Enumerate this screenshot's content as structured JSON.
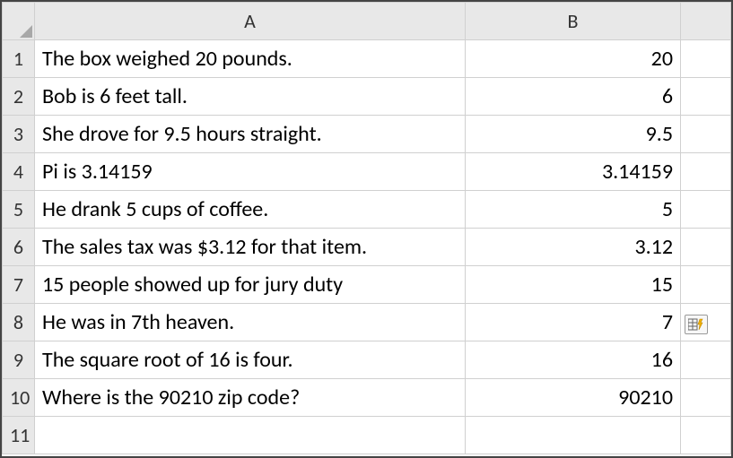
{
  "columns": {
    "A": "A",
    "B": "B"
  },
  "rows": [
    {
      "n": "1",
      "a": "The box weighed 20 pounds.",
      "b": "20"
    },
    {
      "n": "2",
      "a": "Bob is 6 feet tall.",
      "b": "6"
    },
    {
      "n": "3",
      "a": "She drove for 9.5 hours straight.",
      "b": "9.5"
    },
    {
      "n": "4",
      "a": "Pi is 3.14159",
      "b": "3.14159"
    },
    {
      "n": "5",
      "a": "He drank 5 cups of coffee.",
      "b": "5"
    },
    {
      "n": "6",
      "a": "The sales tax was $3.12 for that item.",
      "b": "3.12"
    },
    {
      "n": "7",
      "a": "15 people showed up for jury duty",
      "b": "15"
    },
    {
      "n": "8",
      "a": "He was in 7th heaven.",
      "b": "7"
    },
    {
      "n": "9",
      "a": "The square root of 16 is four.",
      "b": "16"
    },
    {
      "n": "10",
      "a": "Where is the 90210 zip code?",
      "b": "90210"
    },
    {
      "n": "11",
      "a": "",
      "b": ""
    }
  ],
  "smarttag_row_index": 7
}
